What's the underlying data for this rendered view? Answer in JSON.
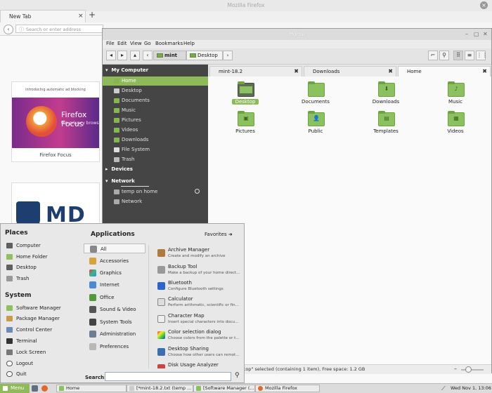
{
  "firefox": {
    "window_title": "Mozilla Firefox",
    "tab_label": "New Tab",
    "url_placeholder": "Search or enter address",
    "tile1_promo": "introducing automatic ad blocking",
    "tile1_heading": "Firefox Focus",
    "tile1_sub": "the privacy brows",
    "tile1_caption": "Firefox Focus",
    "tile2_text": "MD"
  },
  "nemo": {
    "title": "Home",
    "menus": [
      "File",
      "Edit",
      "View",
      "Go",
      "Bookmarks",
      "Help"
    ],
    "breadcrumbs": [
      "mint",
      "Desktop"
    ],
    "sidebar": {
      "my_computer": "My Computer",
      "items": [
        "Home",
        "Desktop",
        "Documents",
        "Music",
        "Pictures",
        "Videos",
        "Downloads",
        "File System",
        "Trash"
      ],
      "devices": "Devices",
      "network": "Network",
      "network_items": [
        "temp on home",
        "Network"
      ]
    },
    "tabs": [
      "mint-18.2",
      "Downloads",
      "Home"
    ],
    "files": [
      {
        "label": "Desktop",
        "glyph": ""
      },
      {
        "label": "Documents",
        "glyph": ""
      },
      {
        "label": "Downloads",
        "glyph": "⬇"
      },
      {
        "label": "Music",
        "glyph": "♪"
      },
      {
        "label": "Pictures",
        "glyph": "▣"
      },
      {
        "label": "Public",
        "glyph": "👤"
      },
      {
        "label": "Templates",
        "glyph": "▤"
      },
      {
        "label": "Videos",
        "glyph": "▦"
      }
    ],
    "status": "ktop\" selected (containing 1 item), Free space: 1.2 GB"
  },
  "mintmenu": {
    "places_title": "Places",
    "places": [
      "Computer",
      "Home Folder",
      "Desktop",
      "Trash"
    ],
    "system_title": "System",
    "system": [
      "Software Manager",
      "Package Manager",
      "Control Center",
      "Terminal",
      "Lock Screen",
      "Logout",
      "Quit"
    ],
    "apps_title": "Applications",
    "favorites_label": "Favorites",
    "categories": [
      "All",
      "Accessories",
      "Graphics",
      "Internet",
      "Office",
      "Sound & Video",
      "System Tools",
      "Administration",
      "Preferences"
    ],
    "apps": [
      {
        "name": "Archive Manager",
        "desc": "Create and modify an archive"
      },
      {
        "name": "Backup Tool",
        "desc": "Make a backup of your home direct..."
      },
      {
        "name": "Bluetooth",
        "desc": "Configure Bluetooth settings"
      },
      {
        "name": "Calculator",
        "desc": "Perform arithmetic, scientific or fin..."
      },
      {
        "name": "Character Map",
        "desc": "Insert special characters into docu..."
      },
      {
        "name": "Color selection dialog",
        "desc": "Choose colors from the palette or t..."
      },
      {
        "name": "Desktop Sharing",
        "desc": "Choose how other users can remot..."
      },
      {
        "name": "Disk Usage Analyzer",
        "desc": ""
      }
    ],
    "search_label": "Search:"
  },
  "taskbar": {
    "menu_label": "Menu",
    "tasks": [
      "Home",
      "[*mint-18.2.txt (temp ...",
      "[Software Manager (...",
      "Mozilla Firefox"
    ],
    "clock": "Wed Nov  1, 13:06"
  }
}
